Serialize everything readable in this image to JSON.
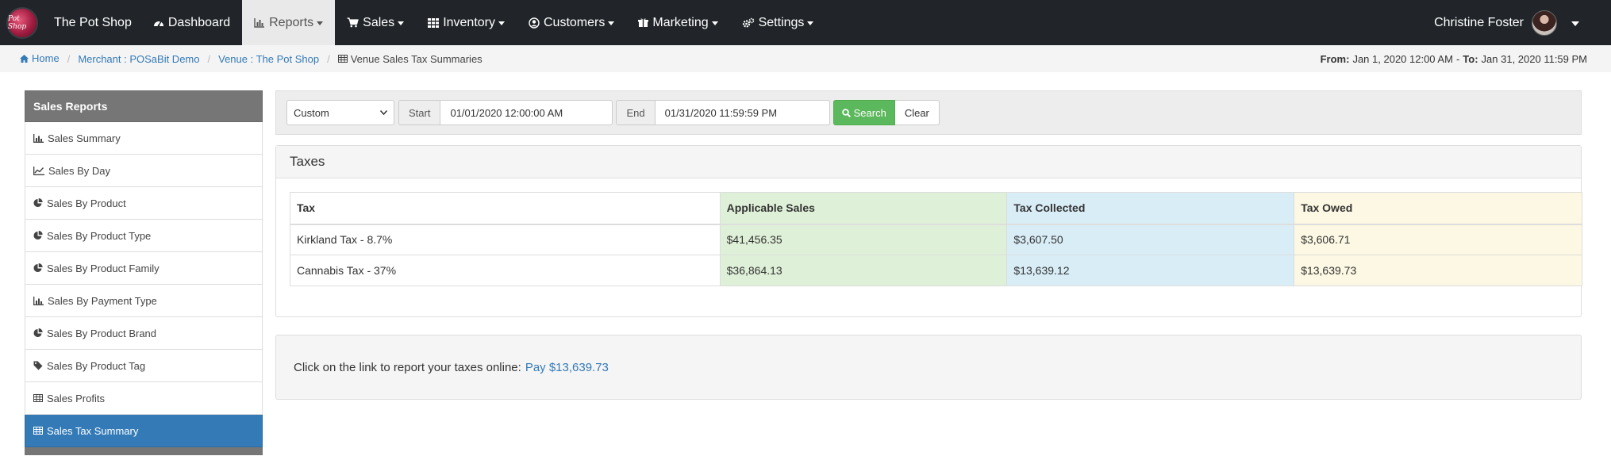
{
  "navbar": {
    "logo_text": "Pot Shop",
    "brand": "The Pot Shop",
    "items": [
      {
        "label": "Dashboard",
        "icon": "dashboard-icon"
      },
      {
        "label": "Reports",
        "icon": "bar-chart-icon"
      },
      {
        "label": "Sales",
        "icon": "cart-icon"
      },
      {
        "label": "Inventory",
        "icon": "grid-icon"
      },
      {
        "label": "Customers",
        "icon": "user-circle-icon"
      },
      {
        "label": "Marketing",
        "icon": "gift-icon"
      },
      {
        "label": "Settings",
        "icon": "cogs-icon"
      }
    ],
    "user_name": "Christine Foster"
  },
  "breadcrumb": {
    "home": "Home",
    "merchant": "Merchant : POSaBit Demo",
    "venue": "Venue : The Pot Shop",
    "current": "Venue Sales Tax Summaries"
  },
  "daterange": {
    "from_label": "From:",
    "from_value": "Jan 1, 2020 12:00 AM",
    "sep": "-",
    "to_label": "To:",
    "to_value": "Jan 31, 2020 11:59 PM"
  },
  "sidebar": {
    "title": "Sales Reports",
    "items": [
      {
        "label": "Sales Summary",
        "icon": "bar-chart-icon"
      },
      {
        "label": "Sales By Day",
        "icon": "line-chart-icon"
      },
      {
        "label": "Sales By Product",
        "icon": "pie-chart-icon"
      },
      {
        "label": "Sales By Product Type",
        "icon": "pie-chart-icon"
      },
      {
        "label": "Sales By Product Family",
        "icon": "pie-chart-icon"
      },
      {
        "label": "Sales By Payment Type",
        "icon": "bar-chart-icon"
      },
      {
        "label": "Sales By Product Brand",
        "icon": "pie-chart-icon"
      },
      {
        "label": "Sales By Product Tag",
        "icon": "tag-icon"
      },
      {
        "label": "Sales Profits",
        "icon": "table-icon"
      },
      {
        "label": "Sales Tax Summary",
        "icon": "table-icon"
      }
    ]
  },
  "filter": {
    "range_option": "Custom",
    "start_label": "Start",
    "start_value": "01/01/2020 12:00:00 AM",
    "end_label": "End",
    "end_value": "01/31/2020 11:59:59 PM",
    "search_label": "Search",
    "clear_label": "Clear"
  },
  "taxes": {
    "title": "Taxes",
    "columns": [
      "Tax",
      "Applicable Sales",
      "Tax Collected",
      "Tax Owed"
    ],
    "rows": [
      [
        "Kirkland Tax - 8.7%",
        "$41,456.35",
        "$3,607.50",
        "$3,606.71"
      ],
      [
        "Cannabis Tax - 37%",
        "$36,864.13",
        "$13,639.12",
        "$13,639.73"
      ]
    ]
  },
  "pay": {
    "text": "Click on the link to report your taxes online:",
    "link": "Pay $13,639.73"
  }
}
